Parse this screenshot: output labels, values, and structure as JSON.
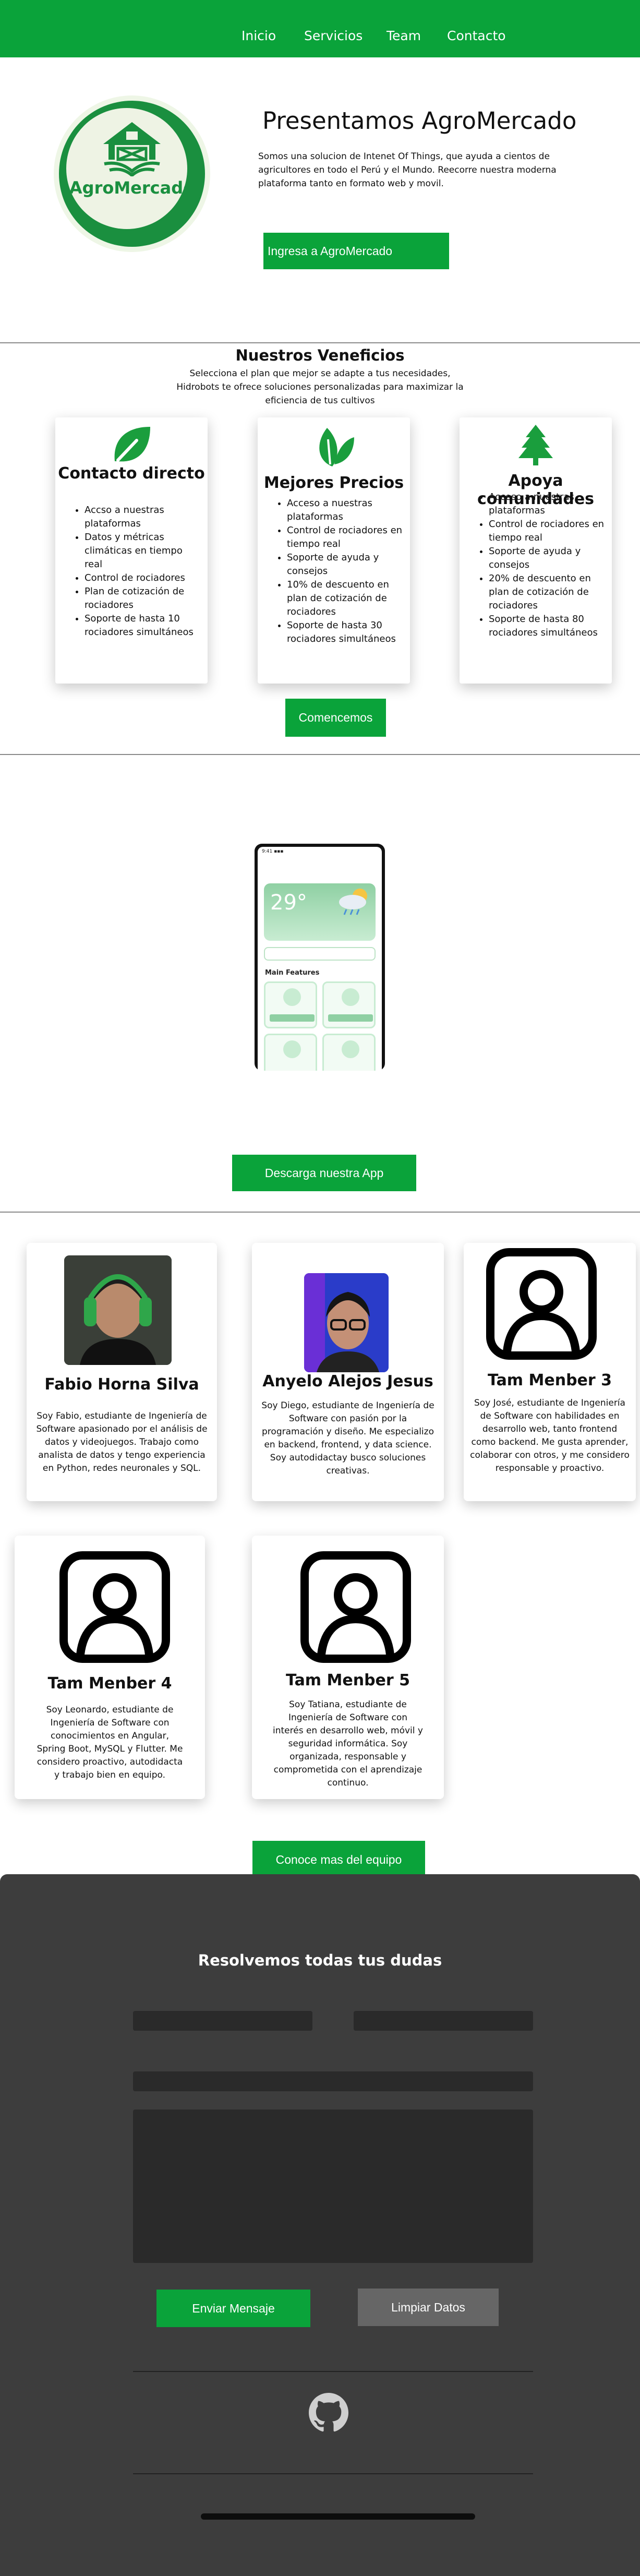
{
  "nav": {
    "items": [
      "Inicio",
      "Servicios",
      "Team",
      "Contacto"
    ]
  },
  "hero": {
    "logo_text": "AgroMercado",
    "title": "Presentamos AgroMercado",
    "text": "Somos una solucion de Intenet Of Things, que ayuda a cientos de agricultores en todo el Perú y el Mundo. Reecorre nuestra moderna plataforma tanto en formato web y movil.",
    "button": "Ingresa a AgroMercado"
  },
  "benefits": {
    "title": "Nuestros Veneficios",
    "subtitle": "Selecciona el plan que mejor se adapte a tus necesidades, Hidrobots te ofrece soluciones personalizadas para maximizar la eficiencia de tus cultivos",
    "cards": [
      {
        "icon": "leaf-icon",
        "title": "Contacto directo",
        "items": [
          "Accso a nuestras plataformas",
          "Datos y métricas climáticas en tiempo real",
          "Control de rociadores",
          "Plan de cotización de rociadores",
          "Soporte de hasta 10 rociadores simultáneos"
        ]
      },
      {
        "icon": "leaves-icon",
        "title": "Mejores Precios",
        "items": [
          "Acceso a nuestras plataformas",
          "Control de rociadores en tiempo real",
          "Soporte de ayuda y consejos",
          "10% de descuento en plan de cotización de rociadores",
          "Soporte de hasta 30 rociadores simultáneos"
        ]
      },
      {
        "icon": "tree-icon",
        "title": "Apoya comunidades",
        "items": [
          "Acceso a nuestras plataformas",
          "Control de rociadores en tiempo real",
          "Soporte de ayuda y consejos",
          "20% de descuento en plan de cotización de rociadores",
          "Soporte de hasta 80 rociadores simultáneos"
        ]
      }
    ],
    "button": "Comencemos"
  },
  "app": {
    "phone_temp": "29°",
    "phone_features": "Main Features",
    "button": "Descarga nuestra App"
  },
  "team": {
    "members": [
      {
        "name": "Fabio Horna Silva",
        "bio": "Soy Fabio, estudiante de Ingeniería de Software apasionado por el análisis de datos y videojuegos. Trabajo como analista de datos y tengo experiencia en Python, redes neuronales y SQL."
      },
      {
        "name": "Anyelo Alejos Jesus",
        "bio": "Soy Diego, estudiante de Ingeniería de Software con pasión por la programación y diseño. Me especializo en backend, frontend, y data science. Soy autodidactay busco soluciones creativas."
      },
      {
        "name": "Tam Menber 3",
        "bio": "Soy José, estudiante de Ingeniería de Software con habilidades en desarrollo web, tanto frontend como backend. Me gusta aprender, colaborar con otros, y me considero responsable y proactivo."
      },
      {
        "name": "Tam Menber 4",
        "bio": "Soy Leonardo, estudiante de Ingeniería de Software con conocimientos en Angular, Spring Boot, MySQL y Flutter. Me considero proactivo, autodidacta y trabajo bien en equipo."
      },
      {
        "name": "Tam Menber 5",
        "bio": "Soy Tatiana, estudiante de Ingeniería de Software con interés en desarrollo web, móvil y seguridad informática. Soy organizada, responsable y comprometida con el aprendizaje continuo."
      }
    ],
    "button": "Conoce mas del equipo"
  },
  "contact": {
    "title": "Resolvemos todas tus dudas",
    "send": "Enviar Mensaje",
    "clear": "Limpiar Datos"
  },
  "colors": {
    "brand_green": "#0aa33a",
    "dark": "#3d3d3d"
  }
}
